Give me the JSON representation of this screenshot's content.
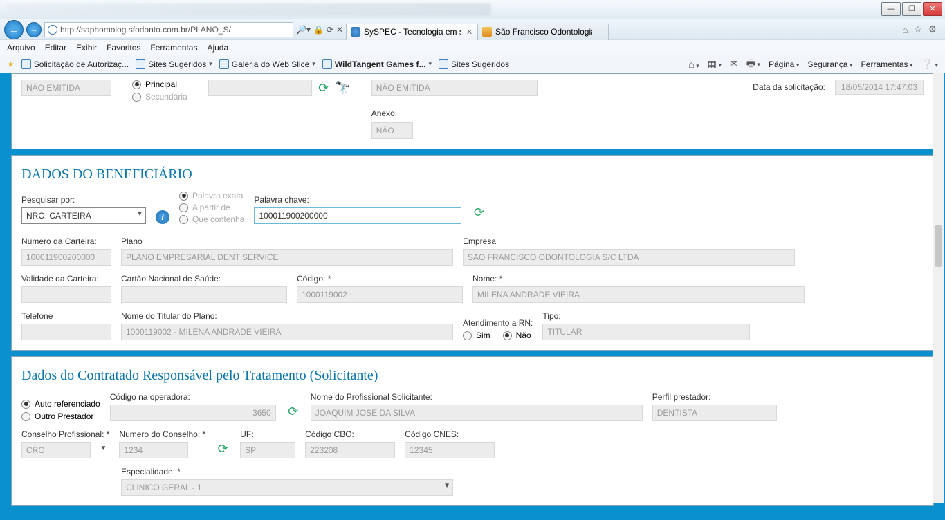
{
  "window": {
    "min": "—",
    "max": "❐",
    "close": "✕"
  },
  "nav": {
    "url": "http://saphomolog.sfodonto.com.br/PLANO_S/",
    "tab1": "SySPEC - Tecnologia em sa...",
    "tab2": "São Francisco Odontologia"
  },
  "menu": {
    "arquivo": "Arquivo",
    "editar": "Editar",
    "exibir": "Exibir",
    "favoritos": "Favoritos",
    "ferramentas": "Ferramentas",
    "ajuda": "Ajuda"
  },
  "favbar": {
    "solic": "Solicitação de Autorizaç...",
    "sites": "Sites Sugeridos",
    "galeria": "Galeria do Web Slice",
    "wild": "WildTangent Games f...",
    "sites2": "Sites Sugeridos",
    "pagina": "Página",
    "seguranca": "Segurança",
    "ferr": "Ferramentas"
  },
  "top": {
    "guia_principal": "Principal",
    "guia_secundaria": "Secundária",
    "nao_emitida": "NÃO EMITIDA",
    "anexo_label": "Anexo:",
    "anexo_val": "NÃO",
    "data_solic_label": "Data da solicitação:",
    "data_solic_val": "18/05/2014 17:47:03"
  },
  "benef": {
    "title": "DADOS DO BENEFICIÁRIO",
    "pesq_label": "Pesquisar por:",
    "pesq_val": "NRO. CARTEIRA",
    "opt_exata": "Palavra exata",
    "opt_apartir": "A partir de",
    "opt_contenha": "Que contenha",
    "chave_label": "Palavra chave:",
    "chave_val": "100011900200000",
    "num_cart_label": "Número da Carteira:",
    "num_cart_val": "100011900200000",
    "plano_label": "Plano",
    "plano_val": "PLANO EMPRESARIAL DENT SERVICE",
    "empresa_label": "Empresa",
    "empresa_val": "SAO FRANCISCO ODONTOLOGIA S/C LTDA",
    "val_cart_label": "Validade da Carteira:",
    "cns_label": "Cartão Nacional de Saúde:",
    "codigo_label": "Código:",
    "codigo_val": "1000119002",
    "nome_label": "Nome:",
    "nome_val": "MILENA ANDRADE VIEIRA",
    "tel_label": "Telefone",
    "titular_label": "Nome do Titular do Plano:",
    "titular_val": "1000119002 - MILENA ANDRADE VIEIRA",
    "rn_label": "Atendimento a RN:",
    "rn_sim": "Sim",
    "rn_nao": "Não",
    "tipo_label": "Tipo:",
    "tipo_val": "TITULAR"
  },
  "contr": {
    "title": "Dados do Contratado Responsável pelo Tratamento (Solicitante)",
    "auto": "Auto referenciado",
    "outro": "Outro Prestador",
    "cod_op_label": "Código na operadora:",
    "cod_op_val": "3650",
    "prof_label": "Nome do Profissional Solicitante:",
    "prof_val": "JOAQUIM JOSE DA SILVA",
    "perfil_label": "Perfil prestador:",
    "perfil_val": "DENTISTA",
    "conselho_label": "Conselho Profissional:",
    "conselho_val": "CRO",
    "num_conselho_label": "Numero do Conselho:",
    "num_conselho_val": "1234",
    "uf_label": "UF:",
    "uf_val": "SP",
    "cbo_label": "Código CBO:",
    "cbo_val": "223208",
    "cnes_label": "Código CNES:",
    "cnes_val": "12345",
    "esp_label": "Especialidade:",
    "esp_val": "CLINICO GERAL - 1"
  }
}
